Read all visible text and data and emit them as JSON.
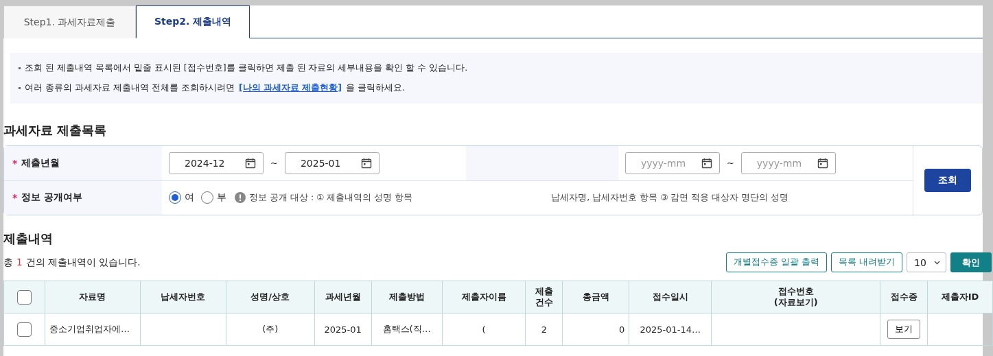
{
  "tabs": [
    {
      "label": "Step1. 과세자료제출",
      "selected": false
    },
    {
      "label": "Step2. 제출내역",
      "selected": true
    }
  ],
  "notice": [
    {
      "text": "조회 된 제출내역 목록에서 밑줄 표시된 [접수번호]를 클릭하면 제출 된 자료의 세부내용을 확인 할 수 있습니다."
    },
    {
      "text": "여러 종류의 과세자료 제출내역 전체를 조회하시려면",
      "link": "[나의 과세자료 제출현황]",
      "after": "을 클릭하세요."
    }
  ],
  "search": {
    "title": "과세자료 제출목록",
    "period": {
      "label": "제출년월",
      "marker": "*",
      "from": "2024-12",
      "to": "2025-01",
      "separator": "~"
    },
    "period_2": {
      "from_placeholder": "yyyy-mm",
      "to_placeholder": "yyyy-mm",
      "separator": "~"
    },
    "disclosure": {
      "label": "정보 공개여부",
      "marker": "*",
      "options": [
        {
          "label": "여",
          "selected": true
        },
        {
          "label": "부",
          "selected": false
        }
      ],
      "info": "정보 공개 대상 : ① 제출내역의 성명 항목",
      "info_2": "납세자명, 납세자번호 항목 ③ 감면 적용 대상자 명단의 성명"
    },
    "button": "조회"
  },
  "results": {
    "title": "제출내역",
    "summary_prefix": "총",
    "count": "1",
    "summary_suffix": "건의 제출내역이 있습니다.",
    "actions": [
      "개별접수증 일괄 출력",
      "목록 내려받기"
    ],
    "page_size": "10",
    "confirm": "확인"
  },
  "table": {
    "all_checked": false,
    "columns": [
      "자료명",
      "납세자번호",
      "성명/상호",
      "과세년월",
      "제출방법",
      "제출자이름",
      "제출\n건수",
      "총금액",
      "접수일시",
      "접수번호\n(자료보기)",
      "접수증",
      "제출자ID"
    ],
    "rows": [
      {
        "checked": false,
        "cells": [
          "중소기업취업자에…",
          "",
          "(주)",
          "2025-01",
          "홈택스(직…",
          "(",
          "2",
          "0",
          "2025-01-14…",
          "",
          "보기",
          ""
        ]
      }
    ]
  }
}
